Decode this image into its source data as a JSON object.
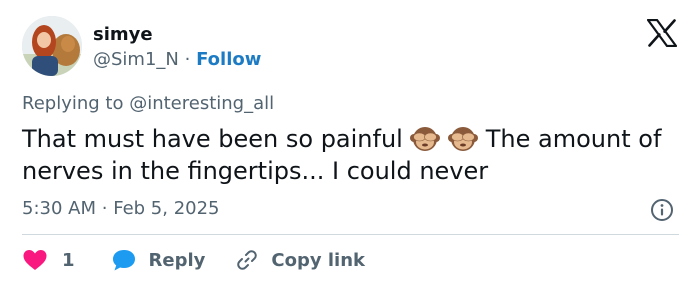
{
  "author": {
    "display_name": "simye",
    "handle": "@Sim1_N",
    "separator": "·",
    "follow_label": "Follow"
  },
  "reply_context": {
    "prefix": "Replying to",
    "mention": "@interesting_all"
  },
  "tweet": {
    "text_before": "That must have been so painful",
    "emoji": [
      "see-no-evil-monkey",
      "see-no-evil-monkey"
    ],
    "text_after": "The amount of nerves in the fingertips... I could never"
  },
  "meta": {
    "time": "5:30 AM",
    "separator": "·",
    "date": "Feb 5, 2025"
  },
  "actions": {
    "like_count": "1",
    "reply_label": "Reply",
    "copy_link_label": "Copy link"
  },
  "colors": {
    "like": "#f91880",
    "reply": "#1d9bf0",
    "follow": "#1d7bc4",
    "muted": "#536471",
    "text": "#0f1419"
  }
}
